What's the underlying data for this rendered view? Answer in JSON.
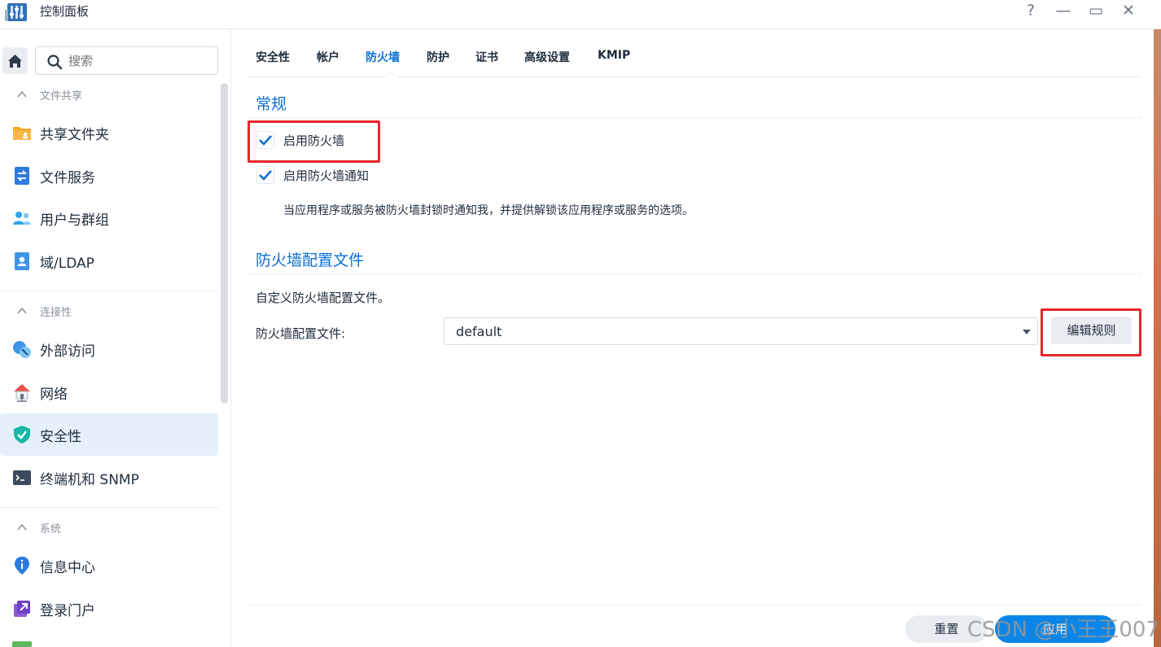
{
  "window": {
    "title": "控制面板",
    "help_icon": "?",
    "minimize_icon": "—",
    "maximize_icon": "▭",
    "close_icon": "✕"
  },
  "sidebar": {
    "search_placeholder": "搜索",
    "sections": [
      {
        "label": "文件共享",
        "items": [
          {
            "label": "共享文件夹",
            "icon": "folder-icon"
          },
          {
            "label": "文件服务",
            "icon": "file-service-icon"
          },
          {
            "label": "用户与群组",
            "icon": "users-icon"
          },
          {
            "label": "域/LDAP",
            "icon": "ldap-icon"
          }
        ]
      },
      {
        "label": "连接性",
        "items": [
          {
            "label": "外部访问",
            "icon": "external-access-icon"
          },
          {
            "label": "网络",
            "icon": "network-icon"
          },
          {
            "label": "安全性",
            "icon": "shield-icon",
            "active": true
          },
          {
            "label": "终端机和 SNMP",
            "icon": "terminal-icon"
          }
        ]
      },
      {
        "label": "系统",
        "items": [
          {
            "label": "信息中心",
            "icon": "info-icon"
          },
          {
            "label": "登录门户",
            "icon": "login-portal-icon"
          }
        ]
      }
    ]
  },
  "tabs": [
    {
      "label": "安全性"
    },
    {
      "label": "帐户"
    },
    {
      "label": "防火墙",
      "active": true
    },
    {
      "label": "防护"
    },
    {
      "label": "证书"
    },
    {
      "label": "高级设置"
    },
    {
      "label": "KMIP"
    }
  ],
  "general": {
    "title": "常规",
    "enable_firewall": {
      "label": "启用防火墙",
      "checked": true
    },
    "enable_notify": {
      "label": "启用防火墙通知",
      "checked": true
    },
    "notify_desc": "当应用程序或服务被防火墙封锁时通知我，并提供解锁该应用程序或服务的选项。"
  },
  "profile": {
    "title": "防火墙配置文件",
    "desc": "自定义防火墙配置文件。",
    "field_label": "防火墙配置文件:",
    "selected": "default",
    "edit_button": "编辑规则"
  },
  "footer": {
    "reset": "重置",
    "apply": "应用"
  },
  "watermark": "CSDN @小王王007",
  "colors": {
    "accent": "#0b6fd6",
    "apply_button": "#0b86e8",
    "highlight_box": "#e8262b",
    "active_nav_bg": "#e6f0fb"
  }
}
